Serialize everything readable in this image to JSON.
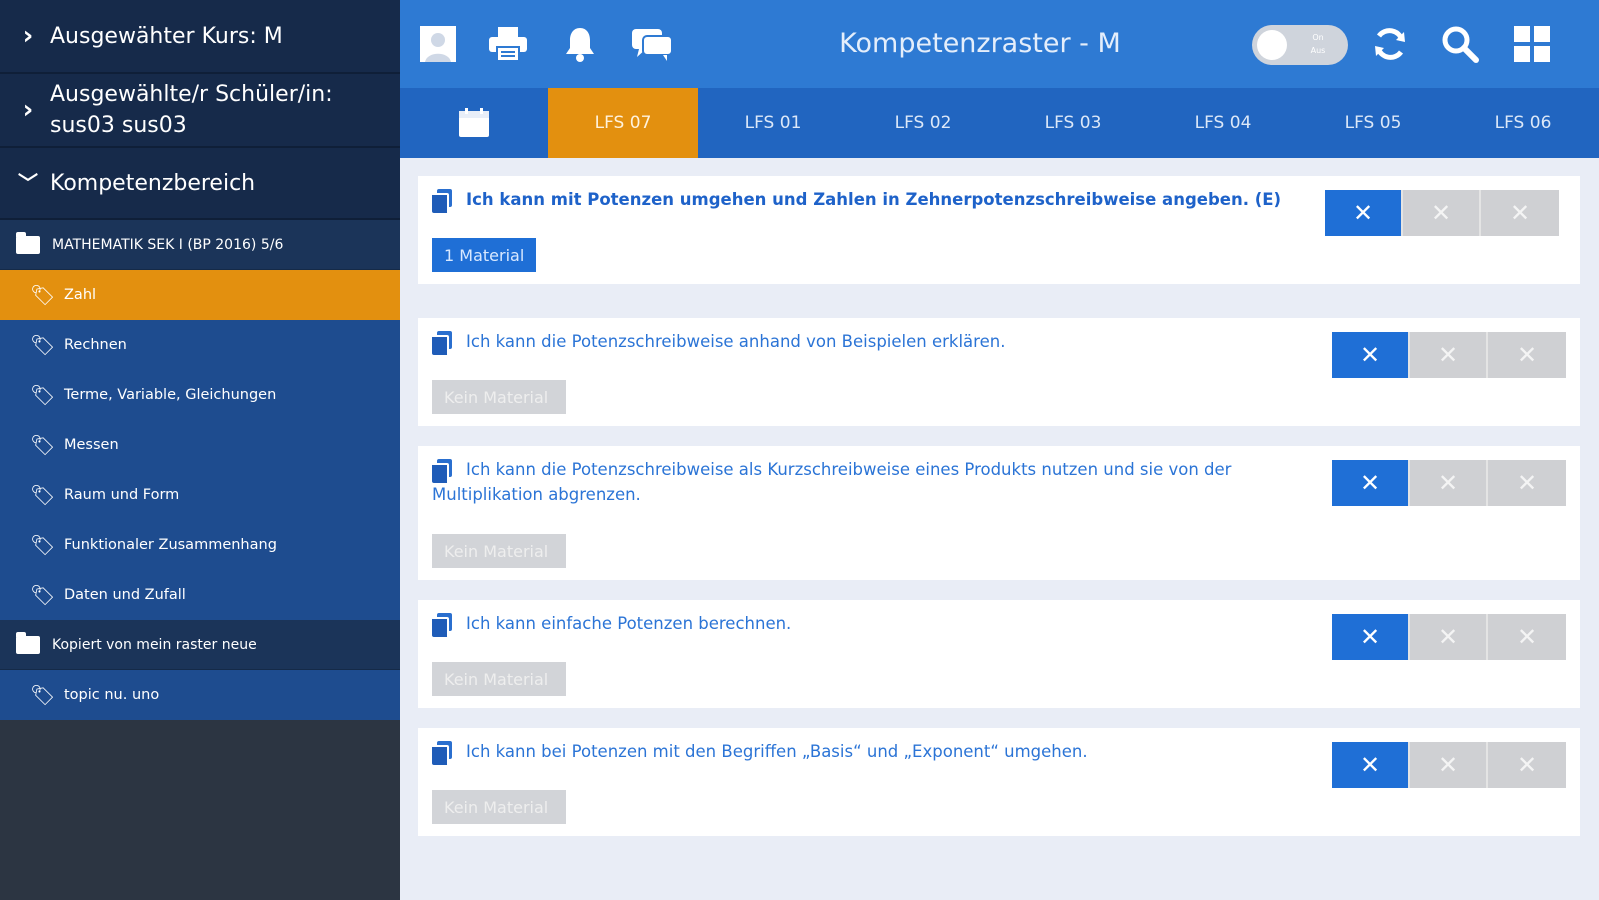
{
  "sidebar": {
    "course": "Ausgewähter Kurs: M",
    "student_line1": "Ausgewählte/r Schüler/in:",
    "student_line2": "sus03 sus03",
    "area": "Kompetenzbereich",
    "folder1": "MATHEMATIK SEK I (BP 2016) 5/6",
    "topics1": [
      "Zahl",
      "Rechnen",
      "Terme, Variable, Gleichungen",
      "Messen",
      "Raum und Form",
      "Funktionaler Zusammenhang",
      "Daten und Zufall"
    ],
    "folder2": "Kopiert von mein raster neue",
    "topics2": [
      "topic nu. uno"
    ]
  },
  "topbar": {
    "title": "Kompetenzraster - M",
    "toggle_line1": "On",
    "toggle_line2": "Aus",
    "icons": [
      "user-icon",
      "print-icon",
      "bell-icon",
      "chat-icon",
      "refresh-icon",
      "search-icon",
      "grid-icon"
    ]
  },
  "tabs": {
    "items": [
      "LFS 07",
      "LFS 01",
      "LFS 02",
      "LFS 03",
      "LFS 04",
      "LFS 05",
      "LFS 06"
    ],
    "active": "LFS 07"
  },
  "competences": [
    {
      "text": "Ich kann mit Potenzen umgehen und Zahlen in Zehnerpotenzschreibweise angeben. (E)",
      "material": "1 Material"
    },
    {
      "text": "Ich kann die Potenzschreibweise anhand von Beispielen erklären.",
      "material": "Kein Material"
    },
    {
      "text_line1": "Ich kann die Potenzschreibweise als Kurzschreibweise eines Produkts nutzen und sie von der",
      "text_line2": "Multiplikation abgrenzen.",
      "material": "Kein Material"
    },
    {
      "text": "Ich kann einfache Potenzen berechnen.",
      "material": "Kein Material"
    },
    {
      "text": "Ich kann bei Potenzen mit den Begriffen „Basis“ und „Exponent“ umgehen.",
      "material": "Kein Material"
    }
  ],
  "x_symbol": "✕",
  "colors": {
    "primary": "#2e7ad3",
    "active": "#e3900f",
    "sidebar_dark": "#162a4a"
  }
}
